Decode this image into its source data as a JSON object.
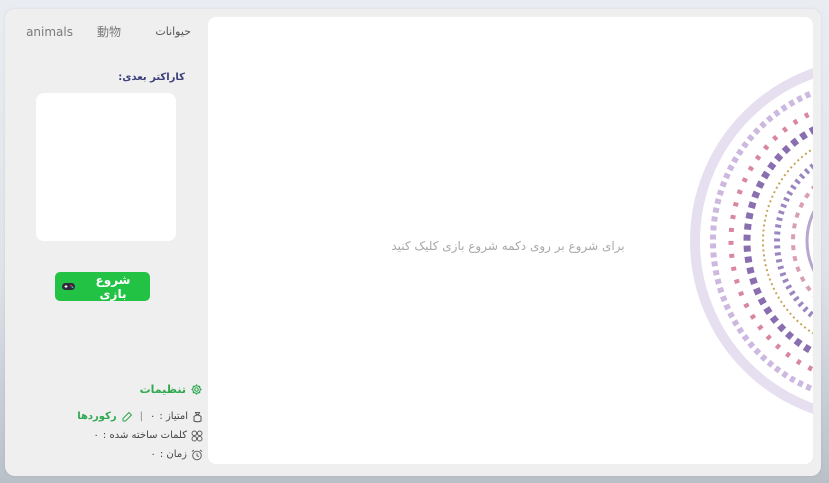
{
  "tabs": [
    "حيوانات",
    "動物",
    "animals"
  ],
  "sidebar": {
    "next_character_label": "کاراکتر بعدی:",
    "start_button_label": "شروع بازی",
    "settings_label": "تنظیمات"
  },
  "stats": {
    "score_label": "امتیاز :",
    "score_value": "۰",
    "records_label": "رکوردها",
    "words_label": "کلمات ساخته شده :",
    "words_value": "۰",
    "time_label": "زمان :",
    "time_value": "۰"
  },
  "main": {
    "hint": "برای شروع بر روی دکمه شروع بازی کلیک کنید"
  },
  "colors": {
    "accent_green": "#22c245",
    "settings_green": "#2fa84f",
    "ornament_purple": "#8a6fb0",
    "ornament_pink": "#d9879f"
  },
  "icons": {
    "start": "gamepad-icon",
    "settings": "gear-icon",
    "score": "money-bag-icon",
    "records": "pencil-edit-icon",
    "words": "circles-icon",
    "time": "alarm-clock-icon"
  }
}
